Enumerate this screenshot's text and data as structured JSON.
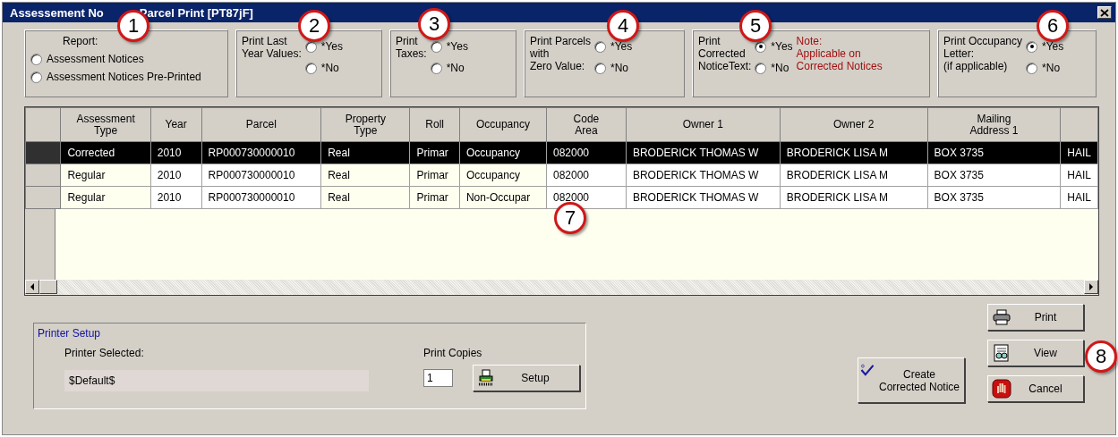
{
  "window": {
    "title_parts": [
      "Assessement No",
      "Parcel Print [PT87jF]"
    ]
  },
  "options": [
    {
      "kind": "report",
      "label": "Report:",
      "choices": [
        {
          "label": "Assessment Notices",
          "selected": false
        },
        {
          "label": "Assessment Notices Pre-Printed",
          "selected": false
        }
      ]
    },
    {
      "kind": "yesno",
      "label": "Print Last\nYear Values:",
      "choices": [
        {
          "label": "*Yes",
          "selected": false
        },
        {
          "label": "*No",
          "selected": false
        }
      ]
    },
    {
      "kind": "yesno",
      "label": "Print\nTaxes:",
      "choices": [
        {
          "label": "*Yes",
          "selected": false
        },
        {
          "label": "*No",
          "selected": false
        }
      ]
    },
    {
      "kind": "yesno",
      "label": "Print Parcels\nwith\nZero Value:",
      "choices": [
        {
          "label": "*Yes",
          "selected": false
        },
        {
          "label": "*No",
          "selected": false
        }
      ]
    },
    {
      "kind": "yesno",
      "label": "Print\nCorrected\nNoticeText:",
      "note": "Note:\nApplicable on\nCorrected Notices",
      "choices": [
        {
          "label": "*Yes",
          "selected": true
        },
        {
          "label": "*No",
          "selected": false
        }
      ]
    },
    {
      "kind": "yesno",
      "label": "Print Occupancy\nLetter:\n(if applicable)",
      "choices": [
        {
          "label": "*Yes",
          "selected": true
        },
        {
          "label": "*No",
          "selected": false
        }
      ]
    }
  ],
  "table": {
    "columns": [
      {
        "label": "Assessment\nType",
        "shaded": true
      },
      {
        "label": "Year",
        "shaded": false
      },
      {
        "label": "Parcel",
        "shaded": false
      },
      {
        "label": "Property\nType",
        "shaded": true
      },
      {
        "label": "Roll",
        "shaded": true
      },
      {
        "label": "Occupancy",
        "shaded": true
      },
      {
        "label": "Code\nArea",
        "shaded": false
      },
      {
        "label": "Owner 1",
        "shaded": false
      },
      {
        "label": "Owner 2",
        "shaded": false
      },
      {
        "label": "Mailing\nAddress 1",
        "shaded": false
      },
      {
        "shaded": false
      }
    ],
    "rows": [
      {
        "selected": true,
        "cells": [
          "Corrected",
          "2010",
          "RP000730000010",
          "Real",
          "Primar",
          "Occupancy",
          "082000",
          "BRODERICK THOMAS W",
          "BRODERICK LISA M",
          "BOX 3735",
          "HAIL"
        ]
      },
      {
        "selected": false,
        "cells": [
          "Regular",
          "2010",
          "RP000730000010",
          "Real",
          "Primar",
          "Occupancy",
          "082000",
          "BRODERICK THOMAS W",
          "BRODERICK LISA M",
          "BOX 3735",
          "HAIL"
        ]
      },
      {
        "selected": false,
        "cells": [
          "Regular",
          "2010",
          "RP000730000010",
          "Real",
          "Primar",
          "Non-Occupar",
          "082000",
          "BRODERICK THOMAS W",
          "BRODERICK LISA M",
          "BOX 3735",
          "HAIL"
        ]
      }
    ]
  },
  "printer_setup": {
    "title": "Printer Setup",
    "printer_label": "Printer Selected:",
    "printer_value": "$Default$",
    "copies_label": "Print Copies",
    "copies_value": "1",
    "setup_button": "Setup"
  },
  "create_button": "Create\nCorrected Notice",
  "action_buttons": [
    {
      "kind": "print",
      "label": "Print"
    },
    {
      "kind": "view",
      "label": "View"
    },
    {
      "kind": "cancel",
      "label": "Cancel"
    }
  ],
  "callouts": [
    "1",
    "2",
    "3",
    "4",
    "5",
    "6",
    "7",
    "8"
  ]
}
